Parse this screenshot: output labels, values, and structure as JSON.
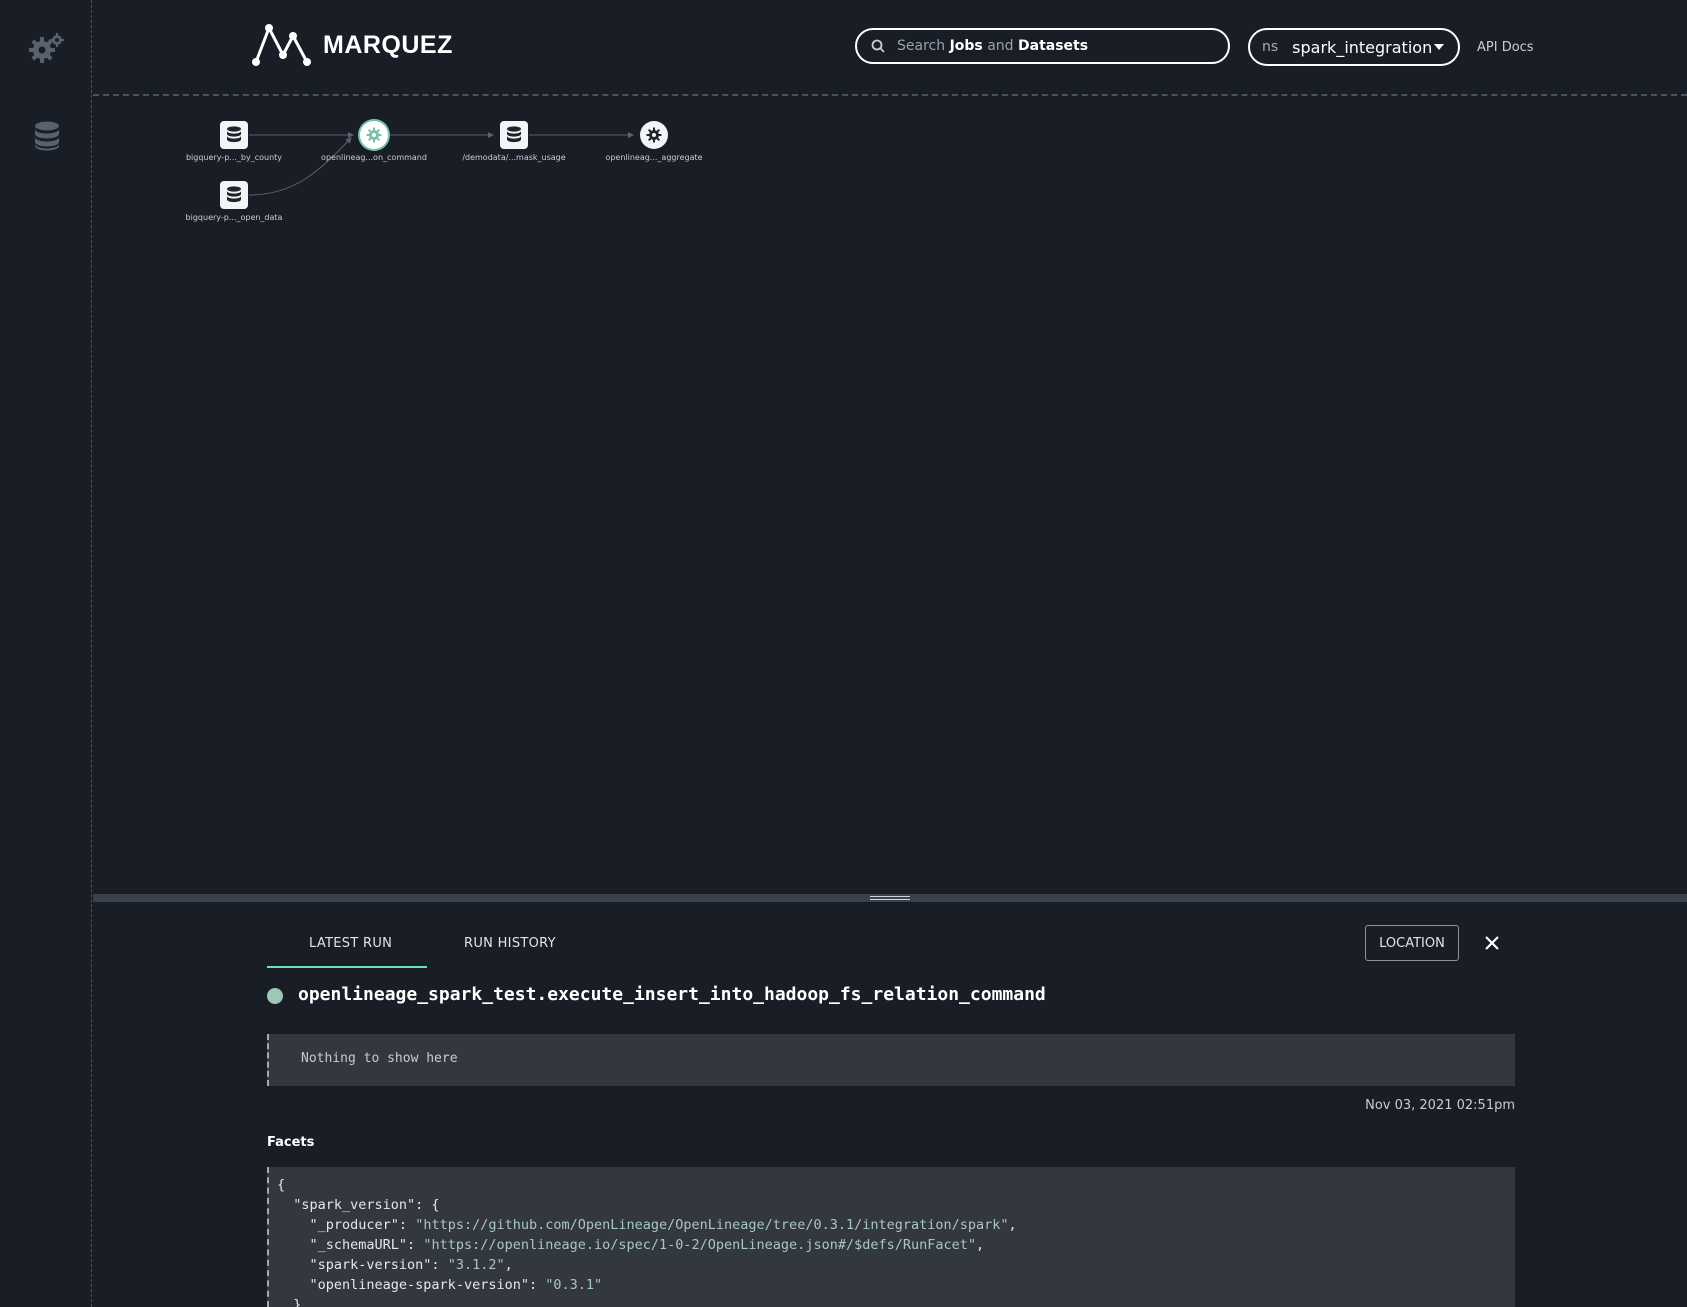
{
  "app": {
    "name": "MARQUEZ"
  },
  "search": {
    "prefix": "Search",
    "jobs": "Jobs",
    "and": "and",
    "datasets": "Datasets"
  },
  "namespace": {
    "label": "ns",
    "value": "spark_integration"
  },
  "header": {
    "api_docs": "API Docs"
  },
  "sidebar": {
    "items": [
      {
        "icon": "gears-icon"
      },
      {
        "icon": "database-icon"
      }
    ]
  },
  "graph": {
    "nodes": [
      {
        "type": "dataset",
        "label": "bigquery-p..._by_county"
      },
      {
        "type": "job",
        "label": "openlineag...on_command",
        "selected": true
      },
      {
        "type": "dataset",
        "label": "/demodata/...mask_usage"
      },
      {
        "type": "job",
        "label": "openlineag..._aggregate"
      },
      {
        "type": "dataset",
        "label": "bigquery-p..._open_data"
      }
    ]
  },
  "drawer": {
    "tabs": [
      "LATEST RUN",
      "RUN HISTORY"
    ],
    "location_button": "LOCATION",
    "job_name": "openlineage_spark_test.execute_insert_into_hadoop_fs_relation_command",
    "status_color": "#9ec7b4",
    "empty_message": "Nothing to show here",
    "timestamp": "Nov 03, 2021 02:51pm",
    "facets_label": "Facets",
    "facets": {
      "open": "{",
      "spark_version_key": "\"spark_version\": {",
      "producer_key": "\"_producer\": ",
      "producer_val": "\"https://github.com/OpenLineage/OpenLineage/tree/0.3.1/integration/spark\"",
      "schema_key": "\"_schemaURL\": ",
      "schema_val": "\"https://openlineage.io/spec/1-0-2/OpenLineage.json#/$defs/RunFacet\"",
      "sv_key": "\"spark-version\": ",
      "sv_val": "\"3.1.2\"",
      "olsv_key": "\"openlineage-spark-version\": ",
      "olsv_val": "\"0.3.1\"",
      "close": "},"
    }
  },
  "colors": {
    "accent": "#71ddbf",
    "background": "#191d26",
    "panel": "#33373f"
  }
}
